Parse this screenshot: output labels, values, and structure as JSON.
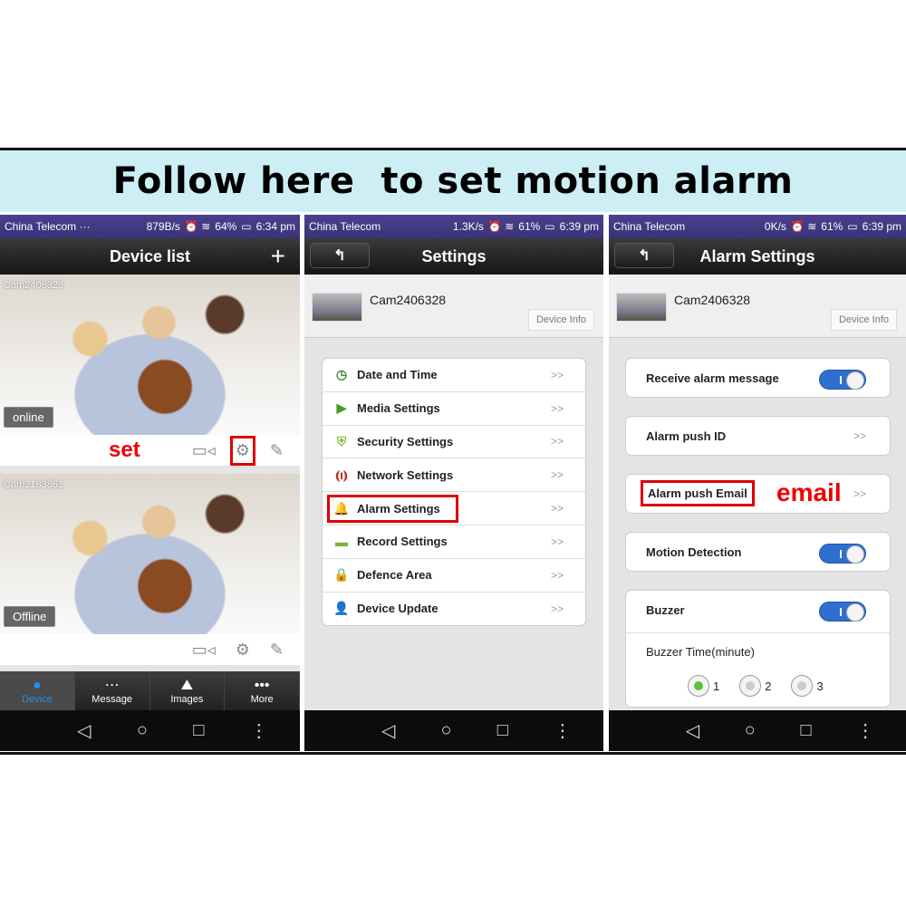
{
  "banner": {
    "title": "Follow here  to set motion alarm",
    "background": "#cdeef4"
  },
  "annotations": {
    "set": "set",
    "email": "email",
    "highlight_color": "#dd0000"
  },
  "phone1": {
    "status": {
      "carrier": "China Telecom ···",
      "speed": "879B/s",
      "battery": "64%",
      "time": "6:34 pm"
    },
    "title": "Device list",
    "add_icon": "+",
    "cameras": [
      {
        "name": "Cam2406328",
        "state": "online"
      },
      {
        "name": "Cam2183861",
        "state": "Offline"
      }
    ],
    "tabs": [
      {
        "label": "Device",
        "icon": "person-icon",
        "active": true
      },
      {
        "label": "Message",
        "icon": "chat-icon"
      },
      {
        "label": "Images",
        "icon": "image-icon"
      },
      {
        "label": "More",
        "icon": "more-icon"
      }
    ]
  },
  "phone2": {
    "status": {
      "carrier": "China Telecom",
      "speed": "1.3K/s",
      "battery": "61%",
      "time": "6:39 pm"
    },
    "title": "Settings",
    "device_name": "Cam2406328",
    "device_info": "Device Info",
    "items": [
      {
        "label": "Date and Time",
        "icon": "clock-icon"
      },
      {
        "label": "Media Settings",
        "icon": "media-icon"
      },
      {
        "label": "Security Settings",
        "icon": "shield-icon"
      },
      {
        "label": "Network Settings",
        "icon": "antenna-icon"
      },
      {
        "label": "Alarm Settings",
        "icon": "bell-icon",
        "highlighted": true
      },
      {
        "label": "Record Settings",
        "icon": "record-icon"
      },
      {
        "label": "Defence Area",
        "icon": "lock-icon"
      },
      {
        "label": "Device Update",
        "icon": "user-update-icon"
      }
    ],
    "chevron": ">>"
  },
  "phone3": {
    "status": {
      "carrier": "China Telecom",
      "speed": "0K/s",
      "battery": "61%",
      "time": "6:39 pm"
    },
    "title": "Alarm Settings",
    "device_name": "Cam2406328",
    "device_info": "Device Info",
    "receive_alarm": {
      "label": "Receive alarm message",
      "on": true
    },
    "push_id": {
      "label": "Alarm push ID"
    },
    "push_email": {
      "label": "Alarm push Email"
    },
    "motion": {
      "label": "Motion Detection",
      "on": true
    },
    "buzzer": {
      "label": "Buzzer",
      "on": true,
      "time_label": "Buzzer Time(minute)",
      "options": [
        "1",
        "2",
        "3"
      ],
      "selected": "1"
    },
    "chevron": ">>"
  }
}
